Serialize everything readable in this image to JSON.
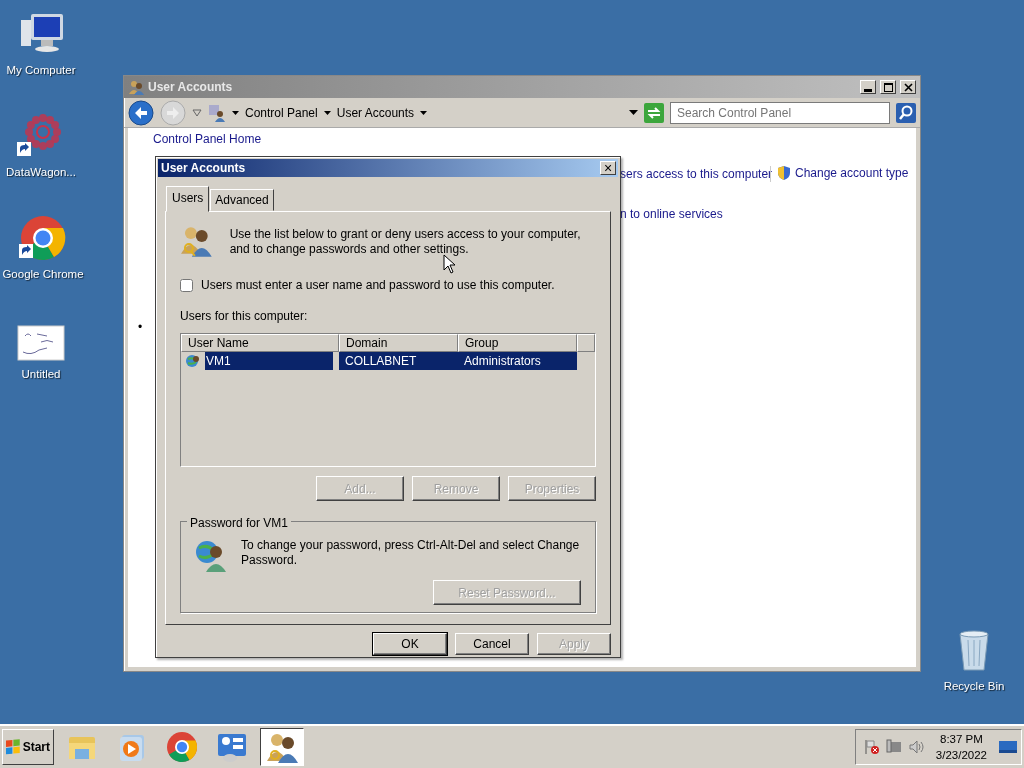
{
  "desktop_icons": [
    {
      "kind": "computer",
      "label": "My Computer",
      "shortcut": false
    },
    {
      "kind": "datawagon",
      "label": "DataWagon...",
      "shortcut": true
    },
    {
      "kind": "chrome",
      "label": "Google Chrome",
      "shortcut": true
    },
    {
      "kind": "sketch",
      "label": "Untitled",
      "shortcut": false
    },
    {
      "kind": "recycle",
      "label": "Recycle Bin",
      "shortcut": false
    }
  ],
  "main_window": {
    "title": "User Accounts",
    "address_path": [
      "Control Panel",
      "User Accounts"
    ],
    "search": {
      "placeholder": "Search Control Panel"
    },
    "links": [
      {
        "kind": "plain",
        "text": "Control Panel Home"
      },
      {
        "kind": "plain",
        "text": "sers access to this computer"
      },
      {
        "kind": "shield",
        "text": "Change account type"
      },
      {
        "kind": "plain",
        "text": "n to online services"
      }
    ],
    "bullet": "•"
  },
  "dialog": {
    "title": "User Accounts",
    "close": "×",
    "tabs": [
      {
        "label": "Users",
        "selected": true
      },
      {
        "label": "Advanced",
        "selected": false
      }
    ],
    "intro": "Use the list below to grant or deny users access to your computer, and to change passwords and other settings.",
    "checkbox": {
      "label": "Users must enter a user name and password to use this computer.",
      "checked": false
    },
    "list_label": "Users for this computer:",
    "columns": [
      "User Name",
      "Domain",
      "Group"
    ],
    "rows": [
      {
        "cells": [
          "VM1",
          "COLLABNET",
          "Administrators"
        ],
        "selected": true
      }
    ],
    "list_buttons": [
      {
        "label": "Add...",
        "disabled": true
      },
      {
        "label": "Remove",
        "disabled": true
      },
      {
        "label": "Properties",
        "disabled": true
      }
    ],
    "password_group": {
      "title": "Password for VM1",
      "text": "To change your password, press Ctrl-Alt-Del and select Change Password.",
      "button": {
        "label": "Reset Password...",
        "disabled": true
      }
    },
    "footer_buttons": [
      {
        "label": "OK",
        "disabled": false,
        "default": true
      },
      {
        "label": "Cancel",
        "disabled": false,
        "default": false
      },
      {
        "label": "Apply",
        "disabled": true,
        "default": false
      }
    ]
  },
  "taskbar": {
    "start": "Start",
    "apps": [
      {
        "kind": "folder",
        "active": false
      },
      {
        "kind": "media",
        "active": false
      },
      {
        "kind": "chrome",
        "active": false
      },
      {
        "kind": "control",
        "active": false
      },
      {
        "kind": "users",
        "active": true
      }
    ],
    "tray": [
      {
        "kind": "flag"
      },
      {
        "kind": "network"
      },
      {
        "kind": "volume"
      }
    ],
    "time": "8:37 PM",
    "date": "3/23/2022"
  }
}
